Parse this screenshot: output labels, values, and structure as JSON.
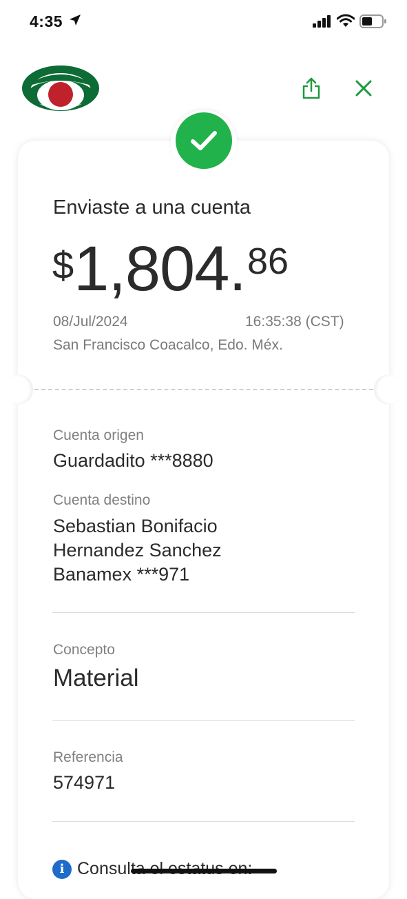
{
  "status_bar": {
    "time": "4:35"
  },
  "header": {
    "logo_icon": "banco-azteca-logo",
    "share_icon": "share-icon",
    "close_icon": "close-icon"
  },
  "receipt": {
    "title": "Enviaste a una cuenta",
    "amount": {
      "currency": "$",
      "integer": "1,804.",
      "decimals": "86"
    },
    "date": "08/Jul/2024",
    "time": "16:35:38 (CST)",
    "location": "San Francisco Coacalco, Edo. Méx.",
    "origin_label": "Cuenta origen",
    "origin_value": "Guardadito ***8880",
    "dest_label": "Cuenta destino",
    "dest_name_line1": "Sebastian Bonifacio",
    "dest_name_line2": "Hernandez Sanchez",
    "dest_bank": "Banamex ***971",
    "concept_label": "Concepto",
    "concept_value": "Material",
    "reference_label": "Referencia",
    "reference_value": "574971",
    "status_info": "Consulta el estatus en:"
  },
  "colors": {
    "success": "#21b24b",
    "accent_green": "#1e9a3f",
    "logo_green": "#0d6b35",
    "logo_red": "#c0222b",
    "info_blue": "#1f6bc9"
  }
}
